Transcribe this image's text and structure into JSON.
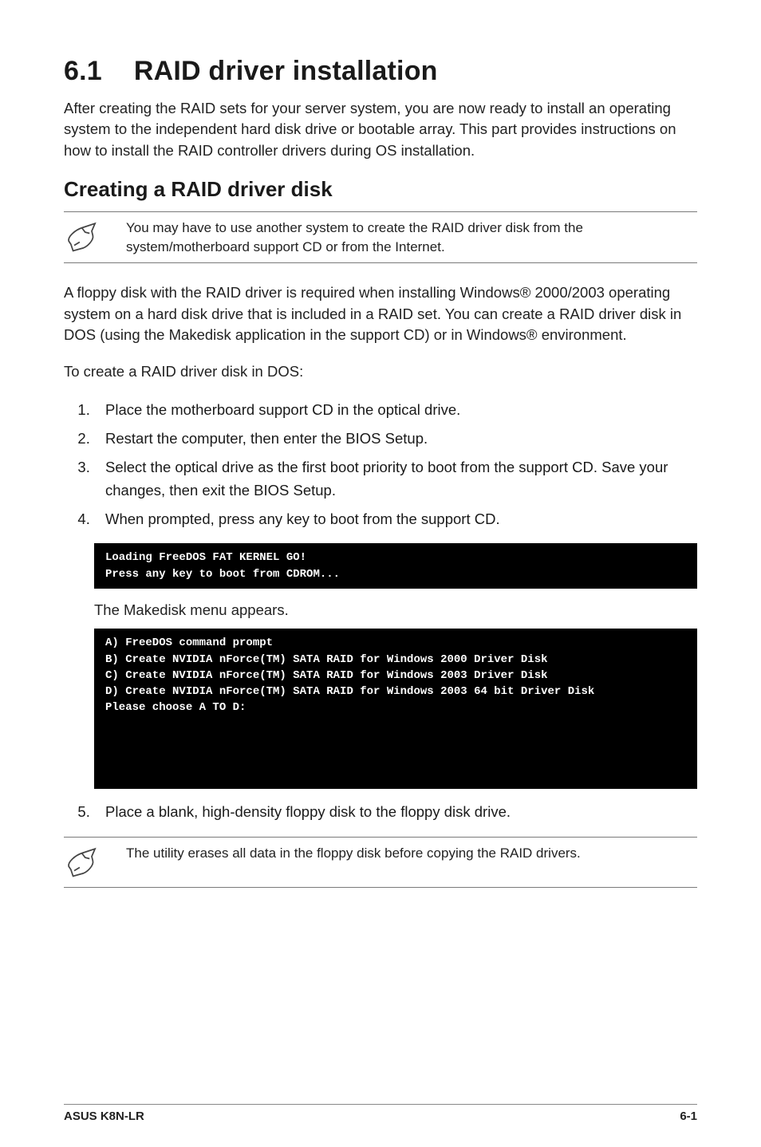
{
  "heading": {
    "number": "6.1",
    "title": "RAID driver installation"
  },
  "intro": "After creating the RAID sets for your server system, you are now ready to install an operating system to the independent hard disk drive or bootable array. This part provides instructions on how to install the RAID controller drivers during OS installation.",
  "subheading": "Creating a RAID driver disk",
  "note1": "You may have to use another system to create the RAID driver disk from the system/motherboard support CD or from the Internet.",
  "body1": "A floppy disk with the RAID driver is required when installing Windows® 2000/2003 operating system on a hard disk drive that is included in a RAID set. You can create a RAID driver disk in DOS (using the Makedisk application in the support CD) or in Windows® environment.",
  "body2": "To create a RAID driver disk in DOS:",
  "steps1": [
    "Place the motherboard support CD in the optical drive.",
    "Restart the computer, then enter the BIOS Setup.",
    "Select the optical drive as the first boot priority to boot from the support CD. Save your changes, then exit the BIOS Setup.",
    "When prompted, press any key to boot from the support CD."
  ],
  "terminal1": "Loading FreeDOS FAT KERNEL GO!\nPress any key to boot from CDROM...",
  "sub1": "The Makedisk menu appears.",
  "terminal2": "A) FreeDOS command prompt\nB) Create NVIDIA nForce(TM) SATA RAID for Windows 2000 Driver Disk\nC) Create NVIDIA nForce(TM) SATA RAID for Windows 2003 Driver Disk\nD) Create NVIDIA nForce(TM) SATA RAID for Windows 2003 64 bit Driver Disk\nPlease choose A TO D:",
  "steps2_start": 5,
  "steps2": [
    "Place a blank, high-density floppy disk to the floppy disk drive."
  ],
  "note2": "The utility erases all data in the floppy disk before copying the RAID drivers.",
  "footer": {
    "left": "ASUS K8N-LR",
    "right": "6-1"
  }
}
